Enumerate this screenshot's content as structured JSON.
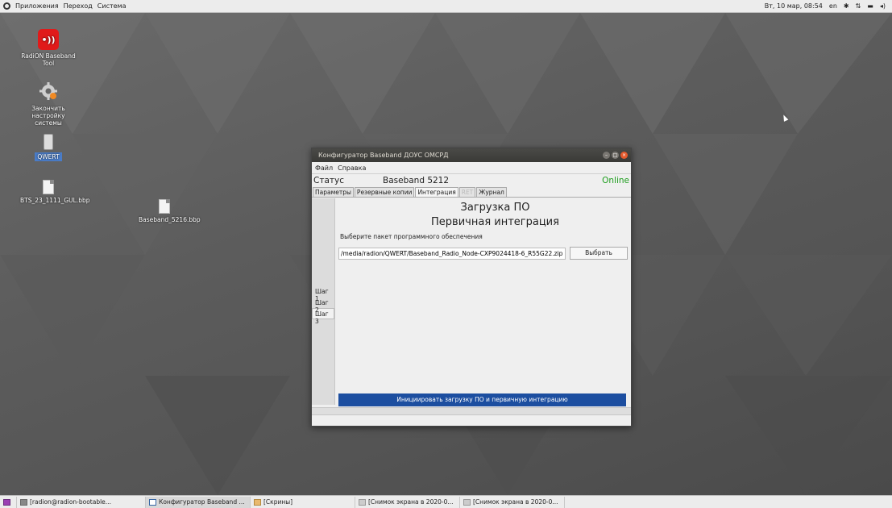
{
  "top_panel": {
    "menus": [
      "Приложения",
      "Переход",
      "Система"
    ],
    "clock": "Вт, 10 мар, 08:54",
    "keyboard_layout": "en"
  },
  "desktop": {
    "icons": [
      {
        "label": "RadiON Baseband Tool",
        "icon": "radio-app-icon"
      },
      {
        "label": "Закончить настройку системы",
        "icon": "gear-icon"
      },
      {
        "label": "QWERT",
        "icon": "usb-drive-icon"
      },
      {
        "label": "BTS_23_1111_GUL.bbp",
        "icon": "file-icon"
      },
      {
        "label": "Baseband_5216.bbp",
        "icon": "file-icon"
      }
    ]
  },
  "window": {
    "title": "Конфигуратор Baseband ДОУС ОМСРД",
    "menu": [
      "Файл",
      "Справка"
    ],
    "status_label": "Статус",
    "device": "Baseband 5212",
    "connection": "Online",
    "tabs": [
      "Параметры",
      "Резервные копии",
      "Интеграция",
      "RET",
      "Журнал"
    ],
    "steps": [
      "Шаг 1",
      "Шаг 2",
      "Шаг 3"
    ],
    "heading": "Загрузка ПО",
    "subheading": "Первичная интеграция",
    "hint": "Выберите пакет программного обеспечения",
    "path_value": "/media/radion/QWERT/Baseband_Radio_Node-CXP9024418-6_R55G22.zip",
    "choose_button": "Выбрать",
    "start_button": "Инициировать загрузку ПО и первичную интеграцию"
  },
  "taskbar": {
    "items": [
      "[radion@radion-bootable...",
      "Конфигуратор Baseband ...",
      "[Скрины]",
      "[Снимок экрана в 2020-0...",
      "[Снимок экрана в 2020-0..."
    ]
  },
  "colors": {
    "online": "#1e9e1e",
    "primary_button": "#1c4ea0",
    "close_button": "#e5592c",
    "app_icon": "#e01a1a"
  }
}
